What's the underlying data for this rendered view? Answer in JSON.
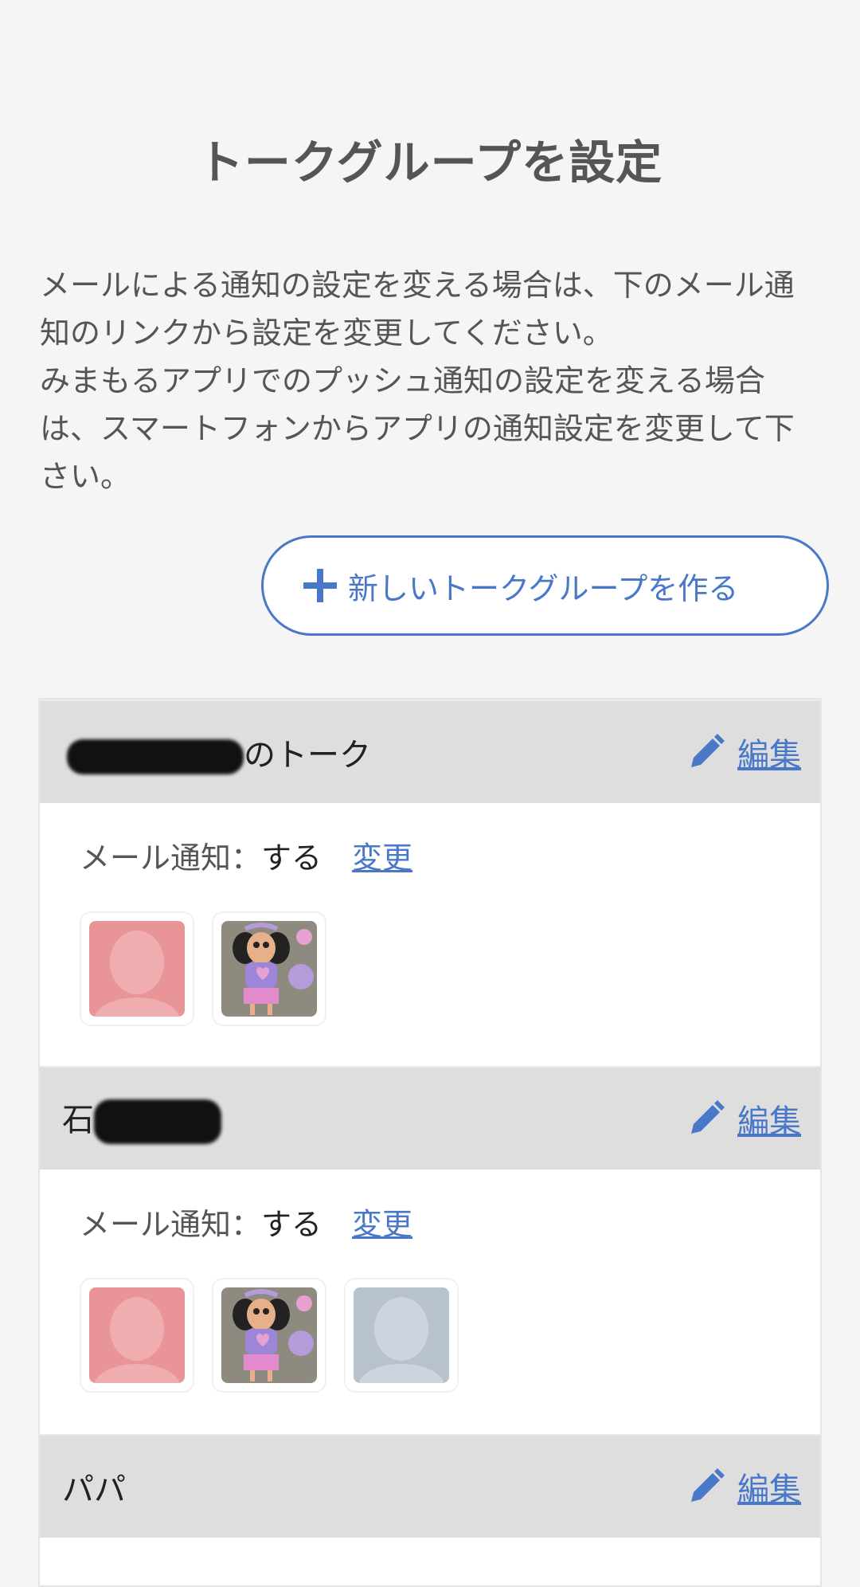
{
  "header": {
    "title": "トークグループを設定"
  },
  "description": {
    "para1": "メールによる通知の設定を変える場合は、下のメール通知のリンクから設定を変更してください。",
    "para2": "みまもるアプリでのプッシュ通知の設定を変える場合は、スマートフォンからアプリの通知設定を変更して下さい。"
  },
  "new_group_button": {
    "label": "新しいトークグループを作る",
    "icon": "plus-icon"
  },
  "groups": [
    {
      "name_suffix": "のトーク",
      "edit_label": "編集",
      "notify_label": "メール通知：",
      "notify_value": "する",
      "change_label": "変更",
      "members": [
        "default-avatar-pink",
        "child-drawing-avatar"
      ]
    },
    {
      "name_prefix": "石",
      "edit_label": "編集",
      "notify_label": "メール通知：",
      "notify_value": "する",
      "change_label": "変更",
      "members": [
        "default-avatar-pink",
        "child-drawing-avatar",
        "default-avatar-gray"
      ]
    },
    {
      "name": "パパ",
      "edit_label": "編集"
    }
  ],
  "colors": {
    "accent": "#4a78c8",
    "header_bg": "#dedede",
    "page_bg": "#f5f5f5"
  }
}
